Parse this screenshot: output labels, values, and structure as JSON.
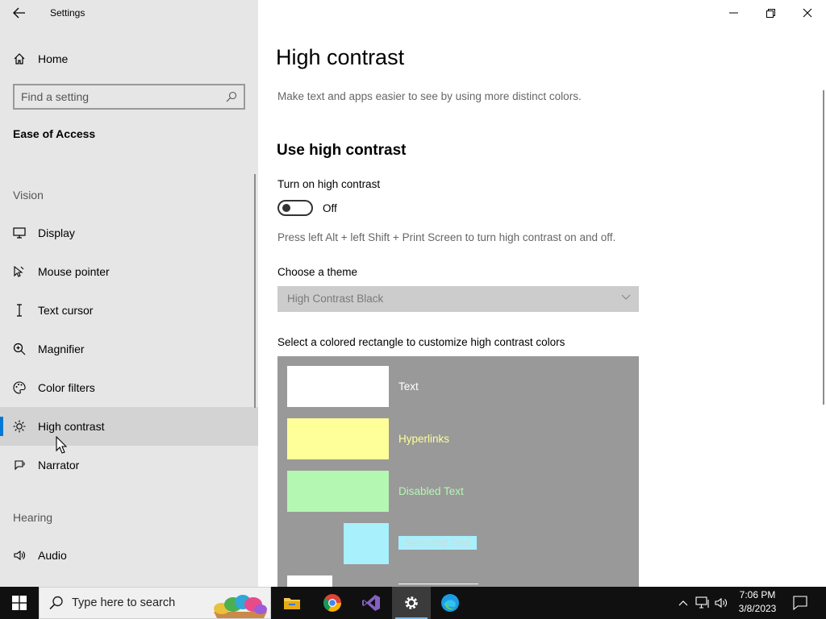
{
  "window": {
    "app_title": "Settings"
  },
  "sidebar": {
    "home_label": "Home",
    "search_placeholder": "Find a setting",
    "section_title": "Ease of Access",
    "groups": {
      "vision": "Vision",
      "hearing": "Hearing"
    },
    "items": [
      {
        "label": "Display",
        "icon": "monitor-icon"
      },
      {
        "label": "Mouse pointer",
        "icon": "mouse-pointer-icon"
      },
      {
        "label": "Text cursor",
        "icon": "text-cursor-icon"
      },
      {
        "label": "Magnifier",
        "icon": "magnifier-icon"
      },
      {
        "label": "Color filters",
        "icon": "palette-icon"
      },
      {
        "label": "High contrast",
        "icon": "sun-icon",
        "selected": true
      },
      {
        "label": "Narrator",
        "icon": "narrator-icon"
      },
      {
        "label": "Audio",
        "icon": "speaker-icon"
      }
    ]
  },
  "main": {
    "title": "High contrast",
    "description": "Make text and apps easier to see by using more distinct colors.",
    "section_heading": "Use high contrast",
    "toggle_label": "Turn on high contrast",
    "toggle_state": "Off",
    "shortcut_hint": "Press left Alt + left Shift + Print Screen to turn high contrast on and off.",
    "theme_label": "Choose a theme",
    "theme_value": "High Contrast Black",
    "palette_label": "Select a colored rectangle to customize high contrast colors",
    "palette": [
      {
        "label": "Text",
        "color": "#ffffff",
        "text_color": "#ffffff"
      },
      {
        "label": "Hyperlinks",
        "color": "#ffff99",
        "text_color": "#ffff99"
      },
      {
        "label": "Disabled Text",
        "color": "#b3f7b3",
        "text_color": "#b3f7b3"
      },
      {
        "label": "Selected Text",
        "color": "#a8f0fc",
        "text_color": "#d8d8d8"
      }
    ]
  },
  "taskbar": {
    "search_placeholder": "Type here to search",
    "time": "7:06 PM",
    "date": "3/8/2023",
    "apps": [
      "file-explorer-icon",
      "chrome-icon",
      "visual-studio-icon",
      "settings-icon",
      "edge-icon"
    ]
  },
  "colors": {
    "accent": "#0078d7",
    "sidebar_bg": "#e6e6e6",
    "selected_bg": "#d3d3d3",
    "palette_bg": "#999999",
    "taskbar_bg": "#101010"
  }
}
